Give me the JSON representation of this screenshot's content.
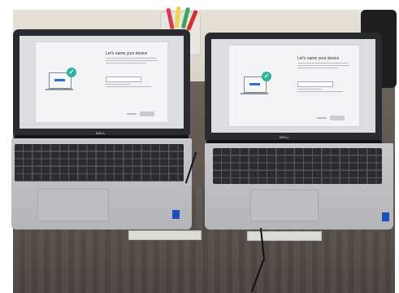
{
  "photo": {
    "subject": "",
    "laptops": [
      {
        "screen_heading": "Let's name your device",
        "brand_logo": "DELL",
        "accent_check_color": "#2fb39b",
        "illustration_bar_color": "#2d6fd6"
      },
      {
        "screen_heading": "Let's name your device",
        "brand_logo": "DELL",
        "accent_check_color": "#2fb39b",
        "illustration_bar_color": "#2d6fd6"
      }
    ],
    "icons": [
      "check-icon"
    ],
    "colors": {
      "desk": "#5a524c",
      "laptop_body": "#b8b9bc",
      "bezel": "#2a2b2e",
      "screen_bg": "#f4f4f6"
    }
  }
}
